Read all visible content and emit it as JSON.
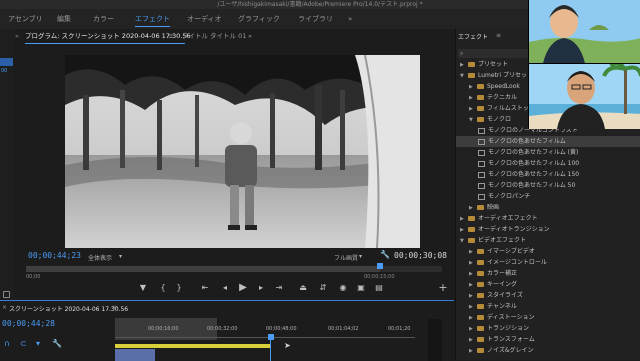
{
  "window": {
    "title": "/ユーザ/hishigakimasaki/書籍/Adobe/Premiere Pro/14.0/テスト.prproj *"
  },
  "workspaces": [
    {
      "label": "アセンブリ"
    },
    {
      "label": "編集"
    },
    {
      "label": "カラー"
    },
    {
      "label": "エフェクト",
      "active": true
    },
    {
      "label": "オーディオ"
    },
    {
      "label": "グラフィック"
    },
    {
      "label": "ライブラリ"
    }
  ],
  "workspace_more": "»",
  "left_strip": {
    "timecode": "00"
  },
  "program_monitor": {
    "tabs": {
      "expand": "»",
      "program": "プログラム: スクリーンショット 2020-04-06 17.30.56",
      "menu": "≡",
      "titles": "タイトル",
      "title01": "タイトル 01",
      "more": "»"
    },
    "playhead_tc": "00;00;44;23",
    "fit": "全体表示",
    "quality": "フル画質",
    "duration_tc": "00;00;30;08",
    "scrub_ticks": [
      "00;00",
      "00;00;15;00"
    ],
    "scrub_fill_fraction": 0.85
  },
  "sequence": {
    "close": "×",
    "name": "スクリーンショット 2020-04-06 17.30.56",
    "menu": "≡",
    "playhead_tc": "00;00;44;28",
    "ruler": [
      "00;00;16;00",
      "00;00;32;00",
      "00;00;48;00",
      "00;01;04;02",
      "00;01;20"
    ]
  },
  "effects_panel": {
    "title": "エフェクト",
    "menu": "≡",
    "more": "»",
    "items": [
      {
        "label": "プリセット",
        "type": "folder",
        "level": 0,
        "open": false
      },
      {
        "label": "Lumetri プリセット",
        "type": "folder",
        "level": 0,
        "open": true
      },
      {
        "label": "SpeedLook",
        "type": "folder",
        "level": 1,
        "open": false
      },
      {
        "label": "テクニカル",
        "type": "folder",
        "level": 1,
        "open": false
      },
      {
        "label": "フィルムストック",
        "type": "folder",
        "level": 1,
        "open": false
      },
      {
        "label": "モノクロ",
        "type": "folder",
        "level": 1,
        "open": true
      },
      {
        "label": "モノクロのノーマルコントラスト",
        "type": "fx",
        "level": 2
      },
      {
        "label": "モノクロの色あせたフィルム",
        "type": "fx",
        "level": 2,
        "selected": true
      },
      {
        "label": "モノクロの色あせたフィルム (黄)",
        "type": "fx",
        "level": 2
      },
      {
        "label": "モノクロの色あせたフィルム 100",
        "type": "fx",
        "level": 2
      },
      {
        "label": "モノクロの色あせたフィルム 150",
        "type": "fx",
        "level": 2
      },
      {
        "label": "モノクロの色あせたフィルム 50",
        "type": "fx",
        "level": 2
      },
      {
        "label": "モノクロパンチ",
        "type": "fx",
        "level": 2
      },
      {
        "label": "映画",
        "type": "folder",
        "level": 1,
        "open": false
      },
      {
        "label": "オーディオエフェクト",
        "type": "folder",
        "level": 0,
        "open": false
      },
      {
        "label": "オーディオトランジション",
        "type": "folder",
        "level": 0,
        "open": false
      },
      {
        "label": "ビデオエフェクト",
        "type": "folder",
        "level": 0,
        "open": true
      },
      {
        "label": "イマーシブビデオ",
        "type": "folder",
        "level": 1,
        "open": false
      },
      {
        "label": "イメージコントロール",
        "type": "folder",
        "level": 1,
        "open": false
      },
      {
        "label": "カラー補正",
        "type": "folder",
        "level": 1,
        "open": false
      },
      {
        "label": "キーイング",
        "type": "folder",
        "level": 1,
        "open": false
      },
      {
        "label": "スタイライズ",
        "type": "folder",
        "level": 1,
        "open": false
      },
      {
        "label": "チャンネル",
        "type": "folder",
        "level": 1,
        "open": false
      },
      {
        "label": "ディストーション",
        "type": "folder",
        "level": 1,
        "open": false
      },
      {
        "label": "トランジション",
        "type": "folder",
        "level": 1,
        "open": false
      },
      {
        "label": "トランスフォーム",
        "type": "folder",
        "level": 1,
        "open": false
      },
      {
        "label": "ノイズ&グレイン",
        "type": "folder",
        "level": 1,
        "open": false
      }
    ]
  },
  "colors": {
    "accent": "#4a9cf5",
    "folder": "#b78a3a",
    "selected": "#3d3d3d"
  },
  "icons": [
    "marker-icon",
    "in-point-icon",
    "out-point-icon",
    "go-to-in-icon",
    "step-back-icon",
    "play-icon",
    "step-forward-icon",
    "go-to-out-icon",
    "lift-icon",
    "extract-icon",
    "export-frame-icon",
    "button-editor-icon",
    "add-icon",
    "wrench-icon",
    "search-icon"
  ]
}
